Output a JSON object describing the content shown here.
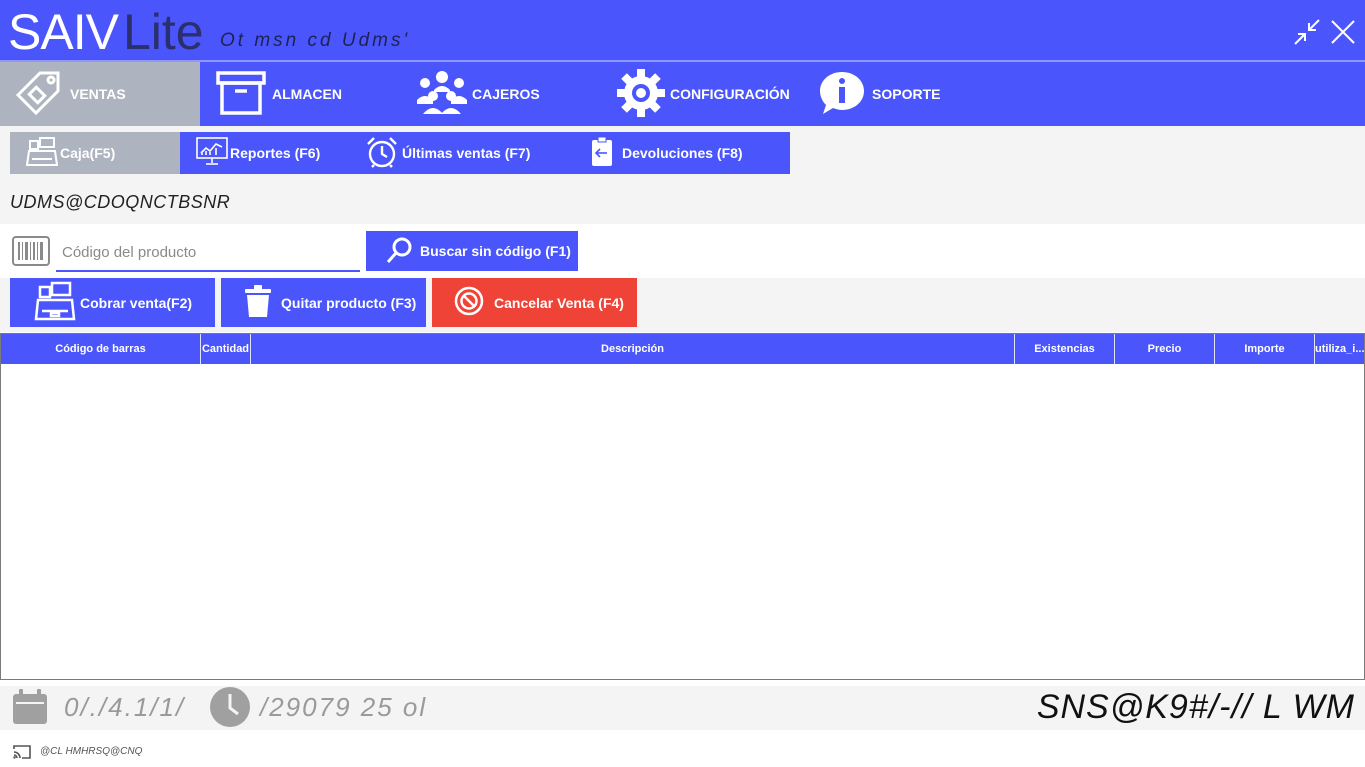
{
  "titlebar": {
    "logo_main": "SAIV",
    "logo_lite": "Lite",
    "subtitle": "Ot msn cd Udms'"
  },
  "menu": {
    "items": [
      {
        "label": "VENTAS",
        "icon": "sales-tag-icon",
        "active": true
      },
      {
        "label": "ALMACEN",
        "icon": "box-icon",
        "active": false
      },
      {
        "label": "CAJEROS",
        "icon": "users-icon",
        "active": false
      },
      {
        "label": "CONFIGURACIÓN",
        "icon": "gear-icon",
        "active": false
      },
      {
        "label": "SOPORTE",
        "icon": "info-bubble-icon",
        "active": false
      }
    ]
  },
  "subtabs": {
    "items": [
      {
        "label": "Caja(F5)",
        "icon": "cash-register-icon",
        "active": true
      },
      {
        "label": "Reportes (F6)",
        "icon": "report-monitor-icon",
        "active": false
      },
      {
        "label": "Últimas ventas (F7)",
        "icon": "alarm-clock-icon",
        "active": false
      },
      {
        "label": "Devoluciones (F8)",
        "icon": "return-clipboard-icon",
        "active": false
      }
    ]
  },
  "section": {
    "title": "UDMS@CDOQNCTBSNR"
  },
  "search": {
    "placeholder": "Código del producto",
    "value": "",
    "button_label": "Buscar sin código (F1)"
  },
  "actions": {
    "charge_label": "Cobrar venta(F2)",
    "remove_label": "Quitar producto (F3)",
    "cancel_label": "Cancelar Venta (F4)",
    "cancel_color": "#f04337"
  },
  "grid": {
    "columns": [
      "Código de barras",
      "Cantidad",
      "Descripción",
      "Existencias",
      "Precio",
      "Importe",
      "utiliza_i..."
    ],
    "rows": []
  },
  "status": {
    "date": "0/./4.1/1/",
    "time": "/29079 25 ol",
    "sale_number": "SNS@K9#/-// L WM"
  },
  "footer": {
    "text": "@CL HMHRSQ@CNQ"
  },
  "colors": {
    "primary": "#4a56fb",
    "active_tab": "#aeb4bf",
    "danger": "#f04337"
  }
}
